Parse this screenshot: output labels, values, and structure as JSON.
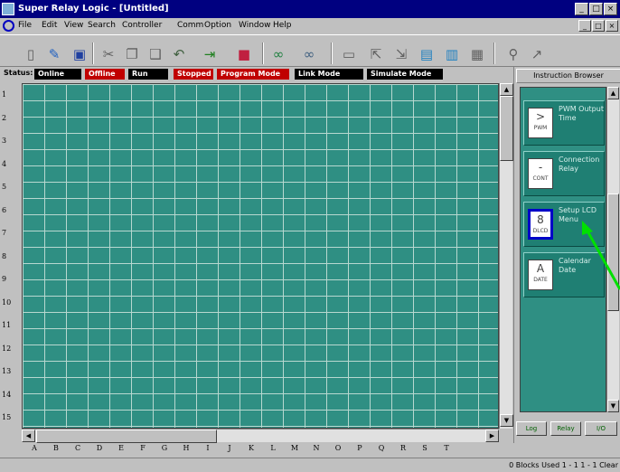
{
  "app": {
    "title": "Super Relay Logic - [Untitled]",
    "window_buttons": [
      "_",
      "□",
      "×"
    ],
    "mdi_buttons": [
      "_",
      "□",
      "×"
    ]
  },
  "menu": [
    "File",
    "Edit",
    "View",
    "Search",
    "Controller",
    "Comm",
    "Option",
    "Window",
    "Help"
  ],
  "toolbar": {
    "icons": [
      "new-file-icon",
      "open-file-icon",
      "save-icon",
      "cut-icon",
      "copy-icon",
      "paste-icon",
      "undo-icon",
      "insert-row-icon",
      "delete-row-icon",
      "find-icon",
      "find-next-icon",
      "read-icon",
      "write-icon",
      "compare-icon",
      "monitor-icon",
      "clear-icon",
      "print-icon",
      "help-icon",
      "pointer-icon"
    ]
  },
  "status": {
    "label": "Status:",
    "badges": [
      {
        "text": "Online",
        "color": "#000000"
      },
      {
        "text": "Offline",
        "color": "#c00000"
      },
      {
        "text": "Run",
        "color": "#000000"
      },
      {
        "text": "Stopped",
        "color": "#c00000"
      },
      {
        "text": "Program Mode",
        "color": "#c00000"
      },
      {
        "text": "Link Mode",
        "color": "#000000"
      },
      {
        "text": "Simulate Mode",
        "color": "#000000"
      }
    ]
  },
  "ladder": {
    "row_numbers": [
      "1",
      "2",
      "3",
      "4",
      "5",
      "6",
      "7",
      "8",
      "9",
      "10",
      "11",
      "12",
      "13",
      "14",
      "15"
    ],
    "column_labels": [
      "A",
      "B",
      "C",
      "D",
      "E",
      "F",
      "G",
      "H",
      "I",
      "J",
      "K",
      "L",
      "M",
      "N",
      "O",
      "P",
      "Q",
      "R",
      "S",
      "T"
    ]
  },
  "browser": {
    "title": "Instruction Browser",
    "items": [
      {
        "code": "PWM",
        "label": "PWM Output Time",
        "glyph": ">"
      },
      {
        "code": "CONT",
        "label": "Connection Relay",
        "glyph": "-"
      },
      {
        "code": "DLCD",
        "label": "Setup LCD Menu",
        "glyph": "8"
      },
      {
        "code": "DATE",
        "label": "Calendar Date",
        "glyph": "A"
      }
    ],
    "bottom_buttons": [
      "Log",
      "Relay",
      "I/O"
    ]
  },
  "statusbar": {
    "text": "0 Blocks Used 1 - 1   1 - 1   Clear"
  },
  "colors": {
    "title_bar": "#000080",
    "grid": "#2f8f83",
    "grid_lines": "#b8d8d0",
    "selection": "#0000c8",
    "arrow": "#00e000"
  }
}
